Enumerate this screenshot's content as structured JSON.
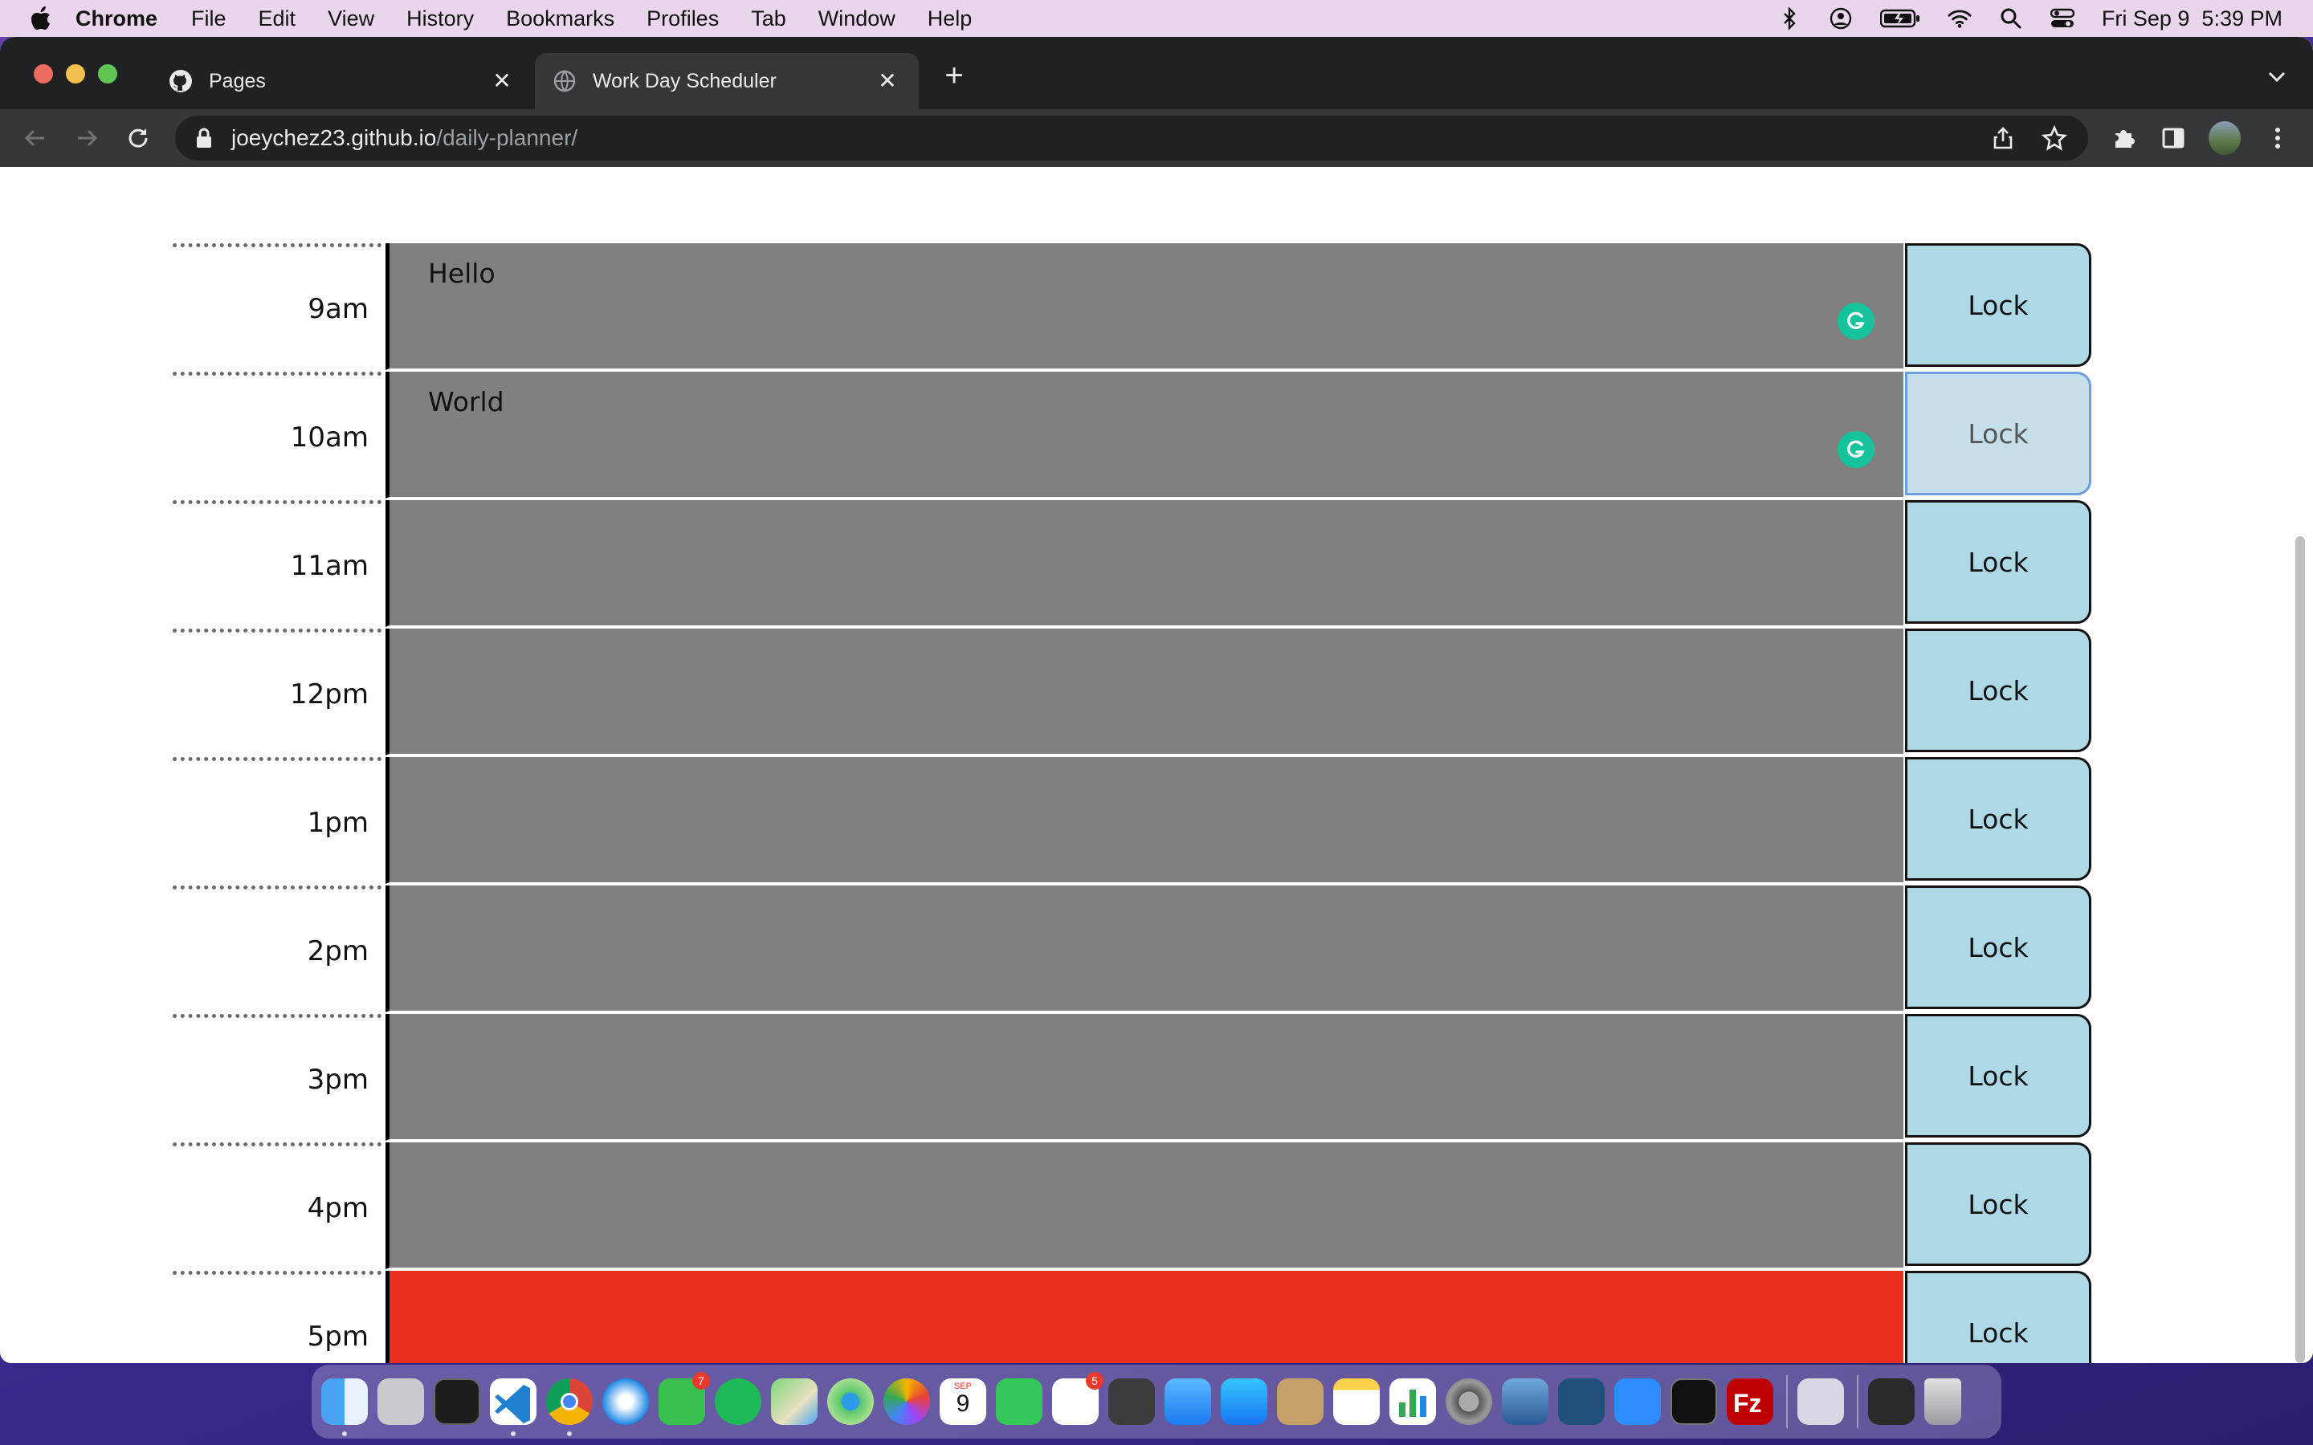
{
  "menubar": {
    "app_name": "Chrome",
    "items": [
      "File",
      "Edit",
      "View",
      "History",
      "Bookmarks",
      "Profiles",
      "Tab",
      "Window",
      "Help"
    ],
    "clock": "Fri Sep 9  5:39 PM",
    "status_icons": [
      "bluetooth-icon",
      "user-icon",
      "battery-icon",
      "wifi-icon",
      "search-icon",
      "control-center-icon"
    ]
  },
  "browser": {
    "tabs": [
      {
        "title": "Pages",
        "icon": "github-icon",
        "active": false
      },
      {
        "title": "Work Day Scheduler",
        "icon": "globe-icon",
        "active": true
      }
    ],
    "url_host": "joeychez23.github.io",
    "url_path": "/daily-planner/"
  },
  "scheduler": {
    "rows": [
      {
        "hour": "9am",
        "text": "Hello",
        "button": "Lock",
        "state": "past"
      },
      {
        "hour": "10am",
        "text": "World",
        "button": "Lock",
        "state": "past"
      },
      {
        "hour": "11am",
        "text": "",
        "button": "Lock",
        "state": "past"
      },
      {
        "hour": "12pm",
        "text": "",
        "button": "Lock",
        "state": "past"
      },
      {
        "hour": "1pm",
        "text": "",
        "button": "Lock",
        "state": "past"
      },
      {
        "hour": "2pm",
        "text": "",
        "button": "Lock",
        "state": "past"
      },
      {
        "hour": "3pm",
        "text": "",
        "button": "Lock",
        "state": "past"
      },
      {
        "hour": "4pm",
        "text": "",
        "button": "Lock",
        "state": "past"
      },
      {
        "hour": "5pm",
        "text": "",
        "button": "Lock",
        "state": "present"
      }
    ],
    "colors": {
      "past": "#808080",
      "present": "#e8301f",
      "button": "#add8e6"
    }
  },
  "dock": {
    "apps": [
      "finder",
      "launchpad",
      "terminal",
      "vscode",
      "chrome",
      "safari",
      "messages",
      "spotify",
      "maps",
      "find-my",
      "photos",
      "calendar",
      "facetime",
      "reminders",
      "calculator",
      "mail",
      "app-store",
      "contacts",
      "notes",
      "numbers",
      "system-preferences",
      "remote-desktop",
      "mysql-workbench",
      "zoom",
      "activity-monitor",
      "filezilla"
    ],
    "messages_badge": "7",
    "reminders_badge": "5",
    "calendar_month": "SEP",
    "calendar_day": "9"
  }
}
